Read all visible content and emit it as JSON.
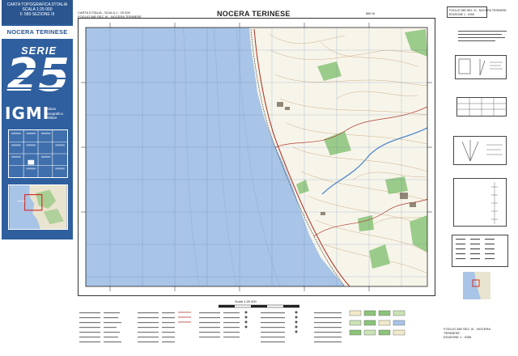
{
  "panel": {
    "header_lines": [
      "CARTA TOPOGRAFICA D'ITALIA",
      "SCALA 1:25 000",
      "F. 580 SEZIONE III"
    ],
    "sheet_name": "NOCERA TERINESE",
    "serie_label": "SERIE",
    "serie_number": "25",
    "logo": "IGMI",
    "institute_lines": [
      "Istituto",
      "Geografico",
      "Militare"
    ],
    "colors": {
      "panel_blue": "#2f5f9e",
      "header_blue": "#2a558f"
    }
  },
  "map": {
    "title": "NOCERA TERINESE",
    "top_left_lines": [
      "CARTA D'ITALIA - SCALA 1 : 25 000",
      "FOGLIO 580 SEZ. III - NOCERA TERINESE"
    ],
    "top_right_text": "580 III",
    "colors": {
      "sea": "#a8c4e6",
      "land": "#f7f5ea",
      "vegetation": "#8cc47a",
      "contour": "#b88b58",
      "road": "#b03a2e",
      "river": "#5a8fc9"
    }
  },
  "info": {
    "sheet_header": [
      "FOGLIO 580 SEZ. III - NOCERA TERINESE"
    ],
    "edition": "EDIZIONE 1 - IGMI"
  },
  "legend": {
    "scale_text": "Scala 1:25 000"
  },
  "sheet_code": [
    "FOGLIO 580 SEZ. III - NOCERA TERINESE",
    "EDIZIONE 1 - IGMI"
  ]
}
